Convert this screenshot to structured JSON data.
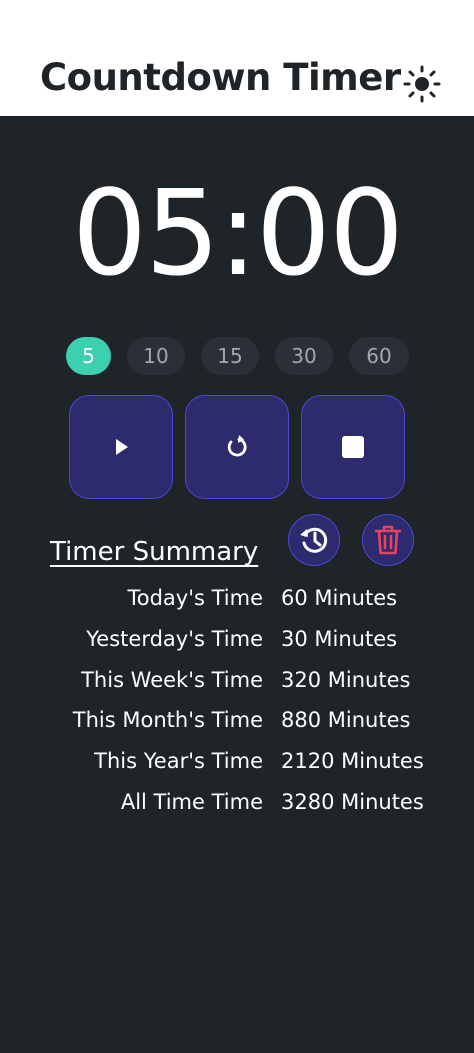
{
  "header": {
    "title": "Countdown Timer",
    "theme_icon": "sun-icon"
  },
  "timer": {
    "display": "05:00"
  },
  "presets": [
    {
      "label": "5",
      "active": true
    },
    {
      "label": "10",
      "active": false
    },
    {
      "label": "15",
      "active": false
    },
    {
      "label": "30",
      "active": false
    },
    {
      "label": "60",
      "active": false
    }
  ],
  "controls": [
    {
      "name": "play",
      "icon": "play-icon"
    },
    {
      "name": "reset",
      "icon": "reset-icon"
    },
    {
      "name": "stop",
      "icon": "stop-icon"
    }
  ],
  "summary": {
    "title": "Timer Summary",
    "history_icon": "history-icon",
    "delete_icon": "trash-icon",
    "rows": [
      {
        "label": "Today's Time",
        "value": "60 Minutes"
      },
      {
        "label": "Yesterday's Time",
        "value": "30 Minutes"
      },
      {
        "label": "This Week's Time",
        "value": "320 Minutes"
      },
      {
        "label": "This Month's Time",
        "value": "880 Minutes"
      },
      {
        "label": "This Year's Time",
        "value": "2120 Minutes"
      },
      {
        "label": "All Time Time",
        "value": "3280 Minutes"
      }
    ]
  },
  "colors": {
    "background": "#1f2429",
    "header_bg": "#ffffff",
    "accent": "#3ccfb0",
    "button_fill": "#2d2a6e",
    "button_border": "#4d47d6",
    "delete": "#e8425f"
  }
}
